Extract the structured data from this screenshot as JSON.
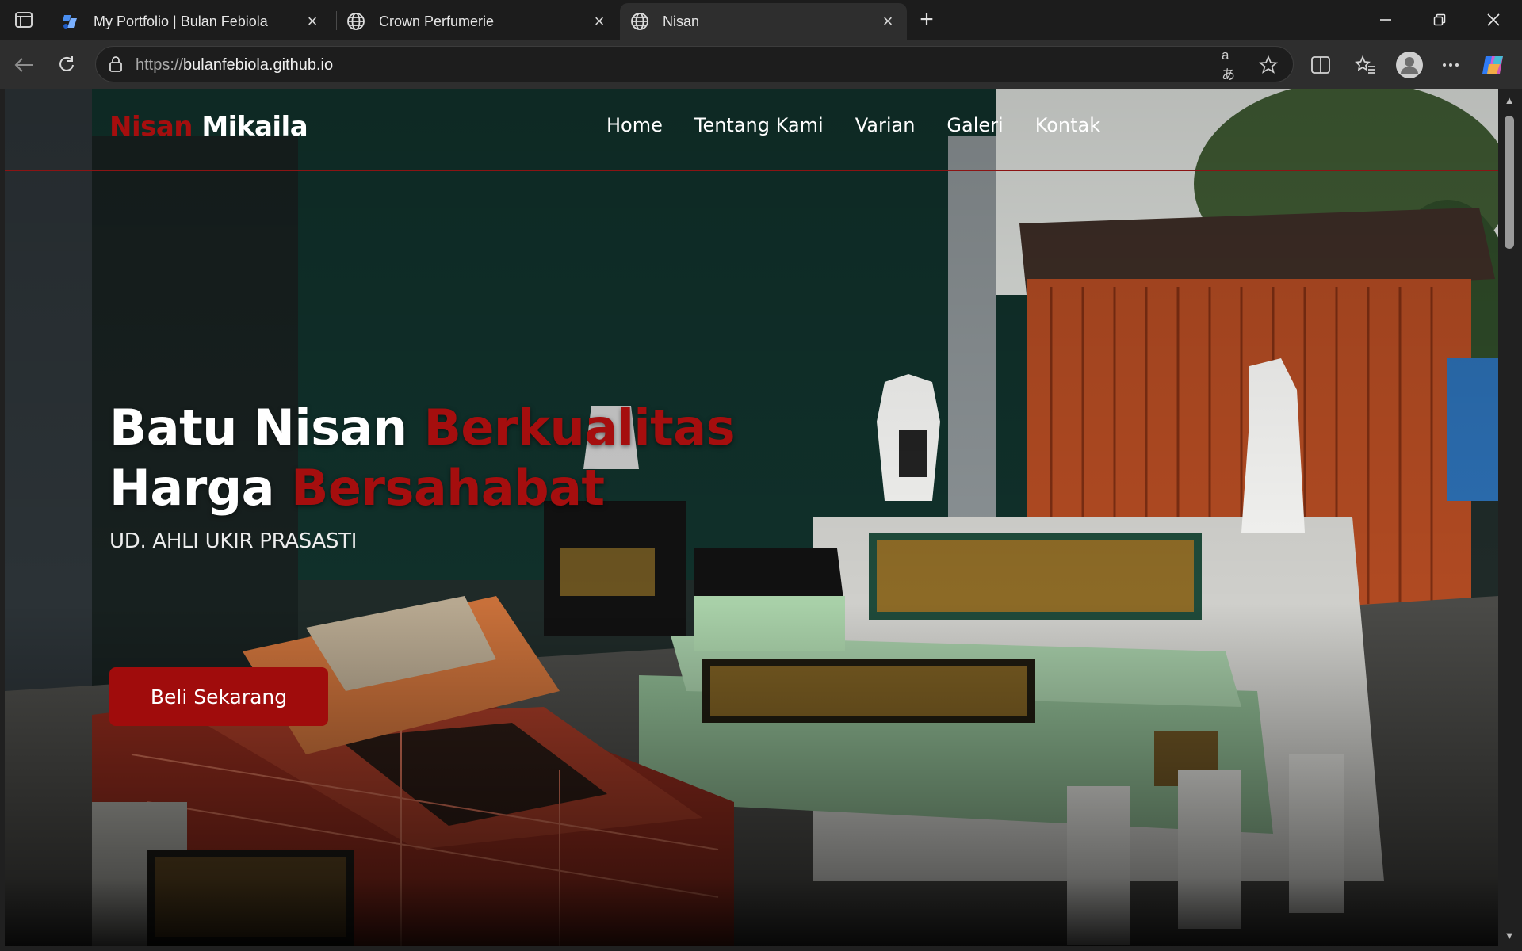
{
  "browser": {
    "tabs": [
      {
        "title": "My Portfolio | Bulan Febiola",
        "favicon": "portfolio-favicon",
        "active": false
      },
      {
        "title": "Crown Perfumerie",
        "favicon": "globe-icon",
        "active": false
      },
      {
        "title": "Nisan",
        "favicon": "globe-icon",
        "active": true
      }
    ],
    "address": {
      "scheme": "https://",
      "host": "bulanfebiola.github.io"
    }
  },
  "site": {
    "brand_accent": "Nisan",
    "brand_main": "Mikaila",
    "nav": [
      "Home",
      "Tentang Kami",
      "Varian",
      "Galeri",
      "Kontak"
    ],
    "hero": {
      "line1_white": "Batu Nisan ",
      "line1_red": "Berkualitas",
      "line2_white": "Harga ",
      "line2_red": "Bersahabat",
      "subtitle": "UD. AHLI UKIR PRASASTI",
      "cta": "Beli Sekarang"
    }
  },
  "colors": {
    "accent": "#a50e0e",
    "button": "#a00c0c",
    "text": "#ffffff"
  }
}
